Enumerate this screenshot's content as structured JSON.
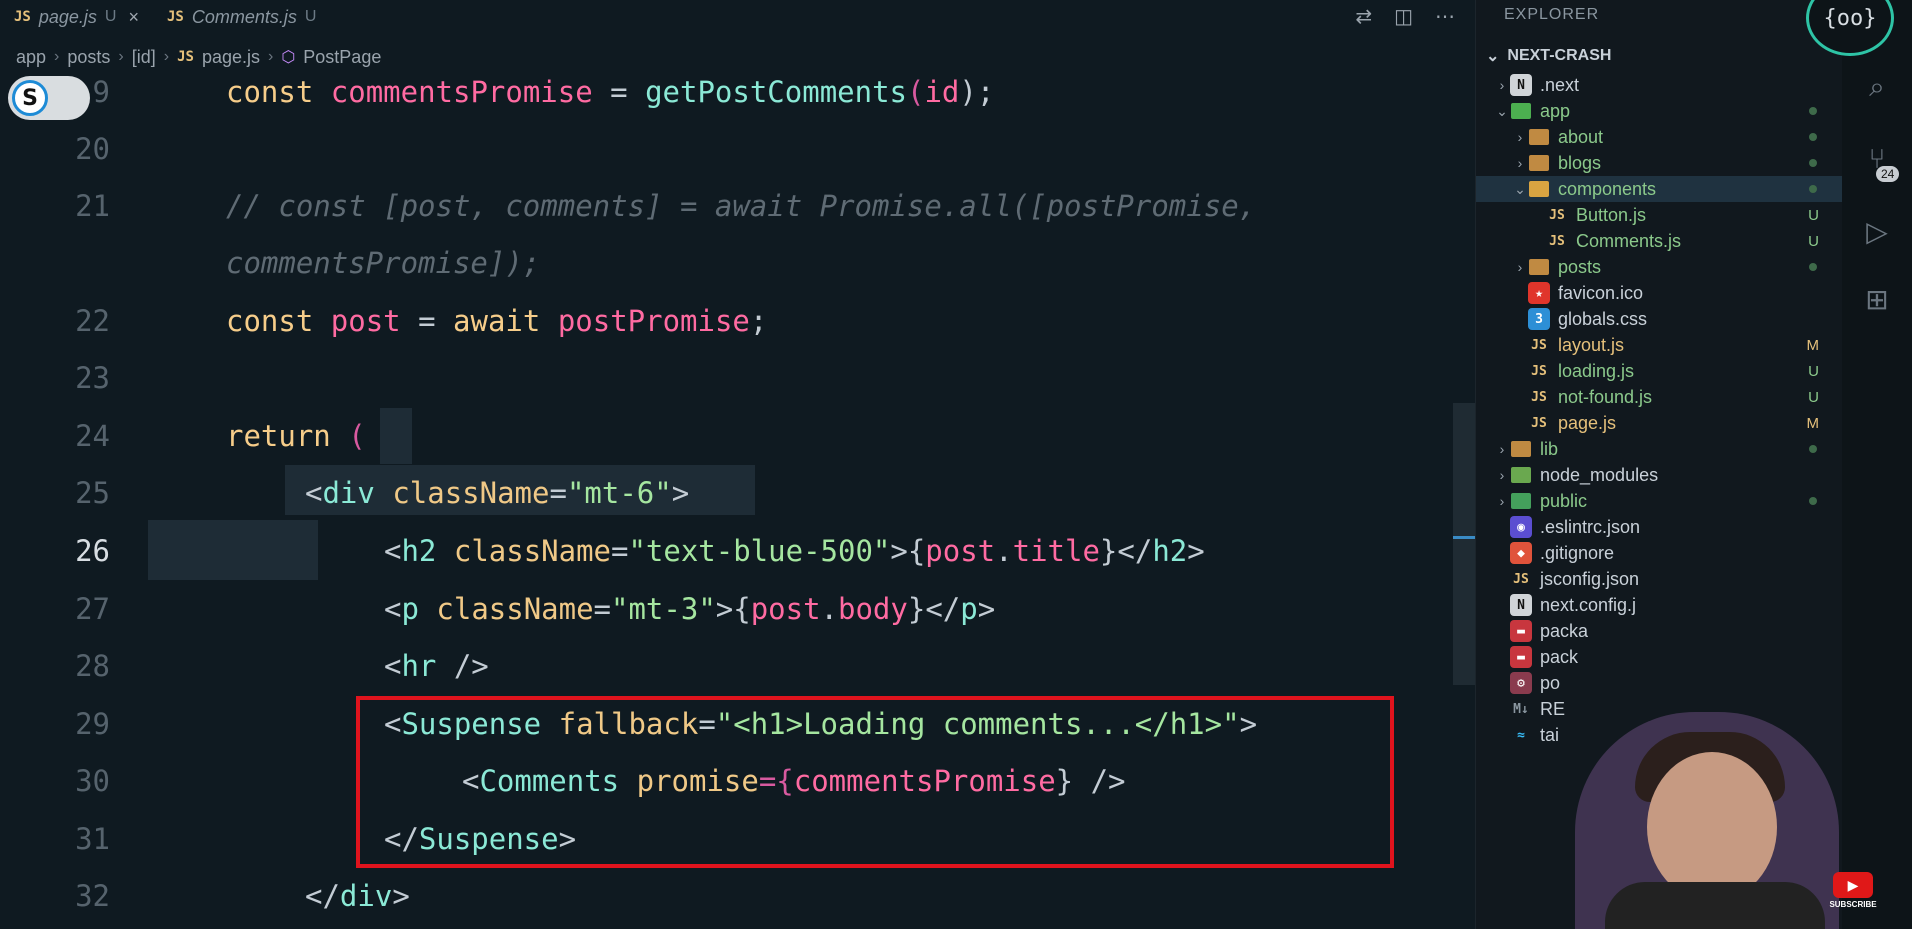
{
  "tabs": [
    {
      "js": "JS",
      "name": "page.js",
      "status": "U",
      "close": "×"
    },
    {
      "js": "JS",
      "name": "Comments.js",
      "status": "U"
    }
  ],
  "breadcrumb": {
    "parts": [
      "app",
      "posts",
      "[id]"
    ],
    "js": "JS",
    "file": "page.js",
    "symbol": "PostPage"
  },
  "toggle_letter": "S",
  "lines": {
    "l9": {
      "num": "9",
      "t1": "const",
      "t2": "commentsPromise",
      "t3": "=",
      "t4": "getPostComments",
      "t5": "(",
      "t6": "id",
      "t7": ");"
    },
    "l20": {
      "num": "20"
    },
    "l21": {
      "num": "21",
      "text": "// const [post, comments] = await Promise.all([postPromise,",
      "text2": "commentsPromise]);"
    },
    "l22": {
      "num": "22",
      "t1": "const",
      "t2": "post",
      "t3": "=",
      "t4": "await",
      "t5": "postPromise",
      ";": ";"
    },
    "l23": {
      "num": "23"
    },
    "l24": {
      "num": "24",
      "t1": "return",
      "t2": "("
    },
    "l25": {
      "num": "25",
      "a": "<",
      "b": "div",
      "c": "className",
      "d": "=",
      "e": "\"mt-6\"",
      "f": ">"
    },
    "l26": {
      "num": "26",
      "a": "<",
      "b": "h2",
      "c": "className",
      "d": "=",
      "e": "\"text-blue-500\"",
      "f": ">{",
      "g": "post",
      "h": ".",
      "i": "title",
      "j": "}</",
      "k": "h2",
      ">": ">"
    },
    "l27": {
      "num": "27",
      "a": "<",
      "b": "p",
      "c": "className",
      "d": "=",
      "e": "\"mt-3\"",
      "f": ">{",
      "g": "post",
      "h": ".",
      "i": "body",
      "j": "}</",
      "k": "p",
      ">": ">"
    },
    "l28": {
      "num": "28",
      "a": "<",
      "b": "hr",
      "c": " />"
    },
    "l29": {
      "num": "29",
      "a": "<",
      "b": "Suspense",
      "c": "fallback",
      "d": "=",
      "e": "\"<h1>Loading comments...</h1>\"",
      "f": ">"
    },
    "l30": {
      "num": "30",
      "a": "<",
      "b": "Comments",
      "c": "promise",
      "d": "={",
      "e": "commentsPromise",
      "f": "} />"
    },
    "l31": {
      "num": "31",
      "a": "</",
      "b": "Suspense",
      "c": ">"
    },
    "l32": {
      "num": "32",
      "a": "</",
      "b": "div",
      "c": ">"
    }
  },
  "explorer": {
    "title": "EXPLORER",
    "project": "NEXT-CRASH",
    "items": [
      {
        "label": ".next",
        "depth": 1,
        "chev": "›",
        "icon": "N"
      },
      {
        "label": "app",
        "depth": 1,
        "chev": "⌄",
        "icon": "folder-app"
      },
      {
        "label": "about",
        "depth": 2,
        "chev": "›",
        "icon": "folder"
      },
      {
        "label": "blogs",
        "depth": 2,
        "chev": "›",
        "icon": "folder"
      },
      {
        "label": "components",
        "depth": 2,
        "chev": "⌄",
        "icon": "folder-components"
      },
      {
        "label": "Button.js",
        "depth": 3,
        "icon": "JS",
        "badge": "U"
      },
      {
        "label": "Comments.js",
        "depth": 3,
        "icon": "JS",
        "badge": "U"
      },
      {
        "label": "posts",
        "depth": 2,
        "chev": "›",
        "icon": "folder"
      },
      {
        "label": "favicon.ico",
        "depth": 2,
        "icon": "star"
      },
      {
        "label": "globals.css",
        "depth": 2,
        "icon": "css"
      },
      {
        "label": "layout.js",
        "depth": 2,
        "icon": "JS",
        "badge": "M"
      },
      {
        "label": "loading.js",
        "depth": 2,
        "icon": "JS",
        "badge": "U"
      },
      {
        "label": "not-found.js",
        "depth": 2,
        "icon": "JS",
        "badge": "U"
      },
      {
        "label": "page.js",
        "depth": 2,
        "icon": "JS",
        "badge": "M"
      },
      {
        "label": "lib",
        "depth": 1,
        "chev": "›",
        "icon": "folder"
      },
      {
        "label": "node_modules",
        "depth": 1,
        "chev": "›",
        "icon": "folder-node"
      },
      {
        "label": "public",
        "depth": 1,
        "chev": "›",
        "icon": "folder-public"
      },
      {
        "label": ".eslintrc.json",
        "depth": 1,
        "icon": "eslint"
      },
      {
        "label": ".gitignore",
        "depth": 1,
        "icon": "git"
      },
      {
        "label": "jsconfig.json",
        "depth": 1,
        "icon": "JS"
      },
      {
        "label": "next.config.j",
        "depth": 1,
        "icon": "N"
      },
      {
        "label": "packa",
        "depth": 1,
        "icon": "npm"
      },
      {
        "label": "pack",
        "depth": 1,
        "icon": "npm"
      },
      {
        "label": "po",
        "depth": 1,
        "icon": "gear"
      },
      {
        "label": "RE",
        "depth": 1,
        "icon": "md"
      },
      {
        "label": "tai",
        "depth": 1,
        "icon": "tailwind"
      }
    ]
  },
  "activity": {
    "scm_count": "24"
  },
  "youtube": {
    "label": "SUBSCRIBE"
  },
  "colors": {
    "highlight": "#e0131d",
    "selected_row": "#1f3240"
  }
}
